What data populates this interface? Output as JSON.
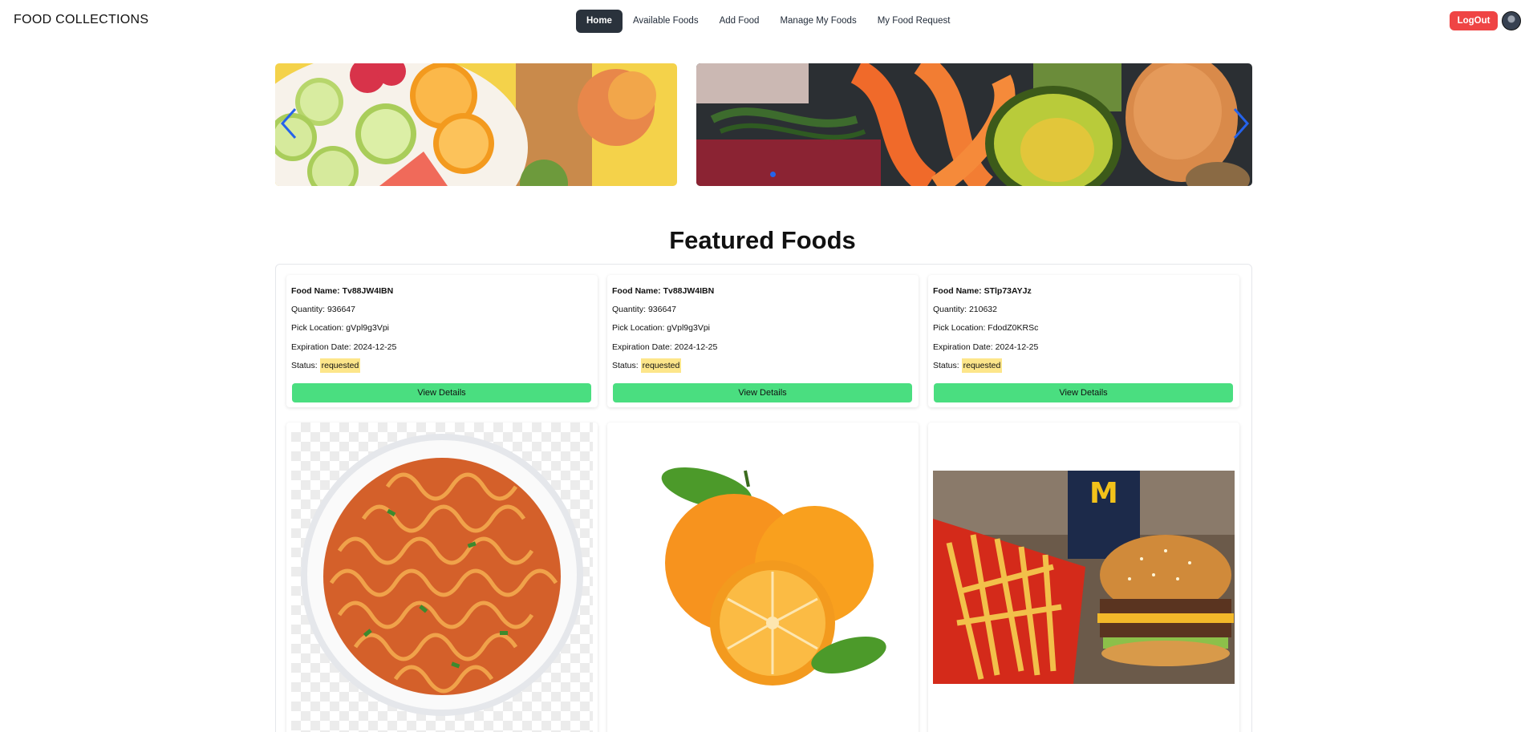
{
  "brand": "FOOD COLLECTIONS",
  "nav": {
    "items": [
      {
        "label": "Home",
        "active": true
      },
      {
        "label": "Available Foods",
        "active": false
      },
      {
        "label": "Add Food",
        "active": false
      },
      {
        "label": "Manage My Foods",
        "active": false
      },
      {
        "label": "My Food Request",
        "active": false
      }
    ],
    "logout_label": "LogOut"
  },
  "carousel": {
    "slides": [
      "fruit-platter-image",
      "produce-and-seafood-image"
    ],
    "accent_color": "#2563eb"
  },
  "featured": {
    "title": "Featured Foods",
    "labels": {
      "food_name": "Food Name:",
      "quantity": "Quantity:",
      "pick_location": "Pick Location:",
      "expiration": "Expiration Date:",
      "status": "Status:"
    },
    "view_details_label": "View Details",
    "cards": [
      {
        "food_name": "Tv88JW4IBN",
        "quantity": "936647",
        "pick_location": "gVpl9g3Vpi",
        "expiration": "2024-12-25",
        "status": "requested"
      },
      {
        "food_name": "Tv88JW4IBN",
        "quantity": "936647",
        "pick_location": "gVpl9g3Vpi",
        "expiration": "2024-12-25",
        "status": "requested"
      },
      {
        "food_name": "STlp73AYJz",
        "quantity": "210632",
        "pick_location": "FdodZ0KRSc",
        "expiration": "2024-12-25",
        "status": "requested"
      }
    ],
    "image_cards": [
      "noodle-bowl-image",
      "oranges-image",
      "burger-and-fries-image"
    ]
  },
  "colors": {
    "active_nav_bg": "#2a323c",
    "logout_bg": "#ef4444",
    "view_button_bg": "#4ade80",
    "status_badge_bg": "#fde68a"
  }
}
